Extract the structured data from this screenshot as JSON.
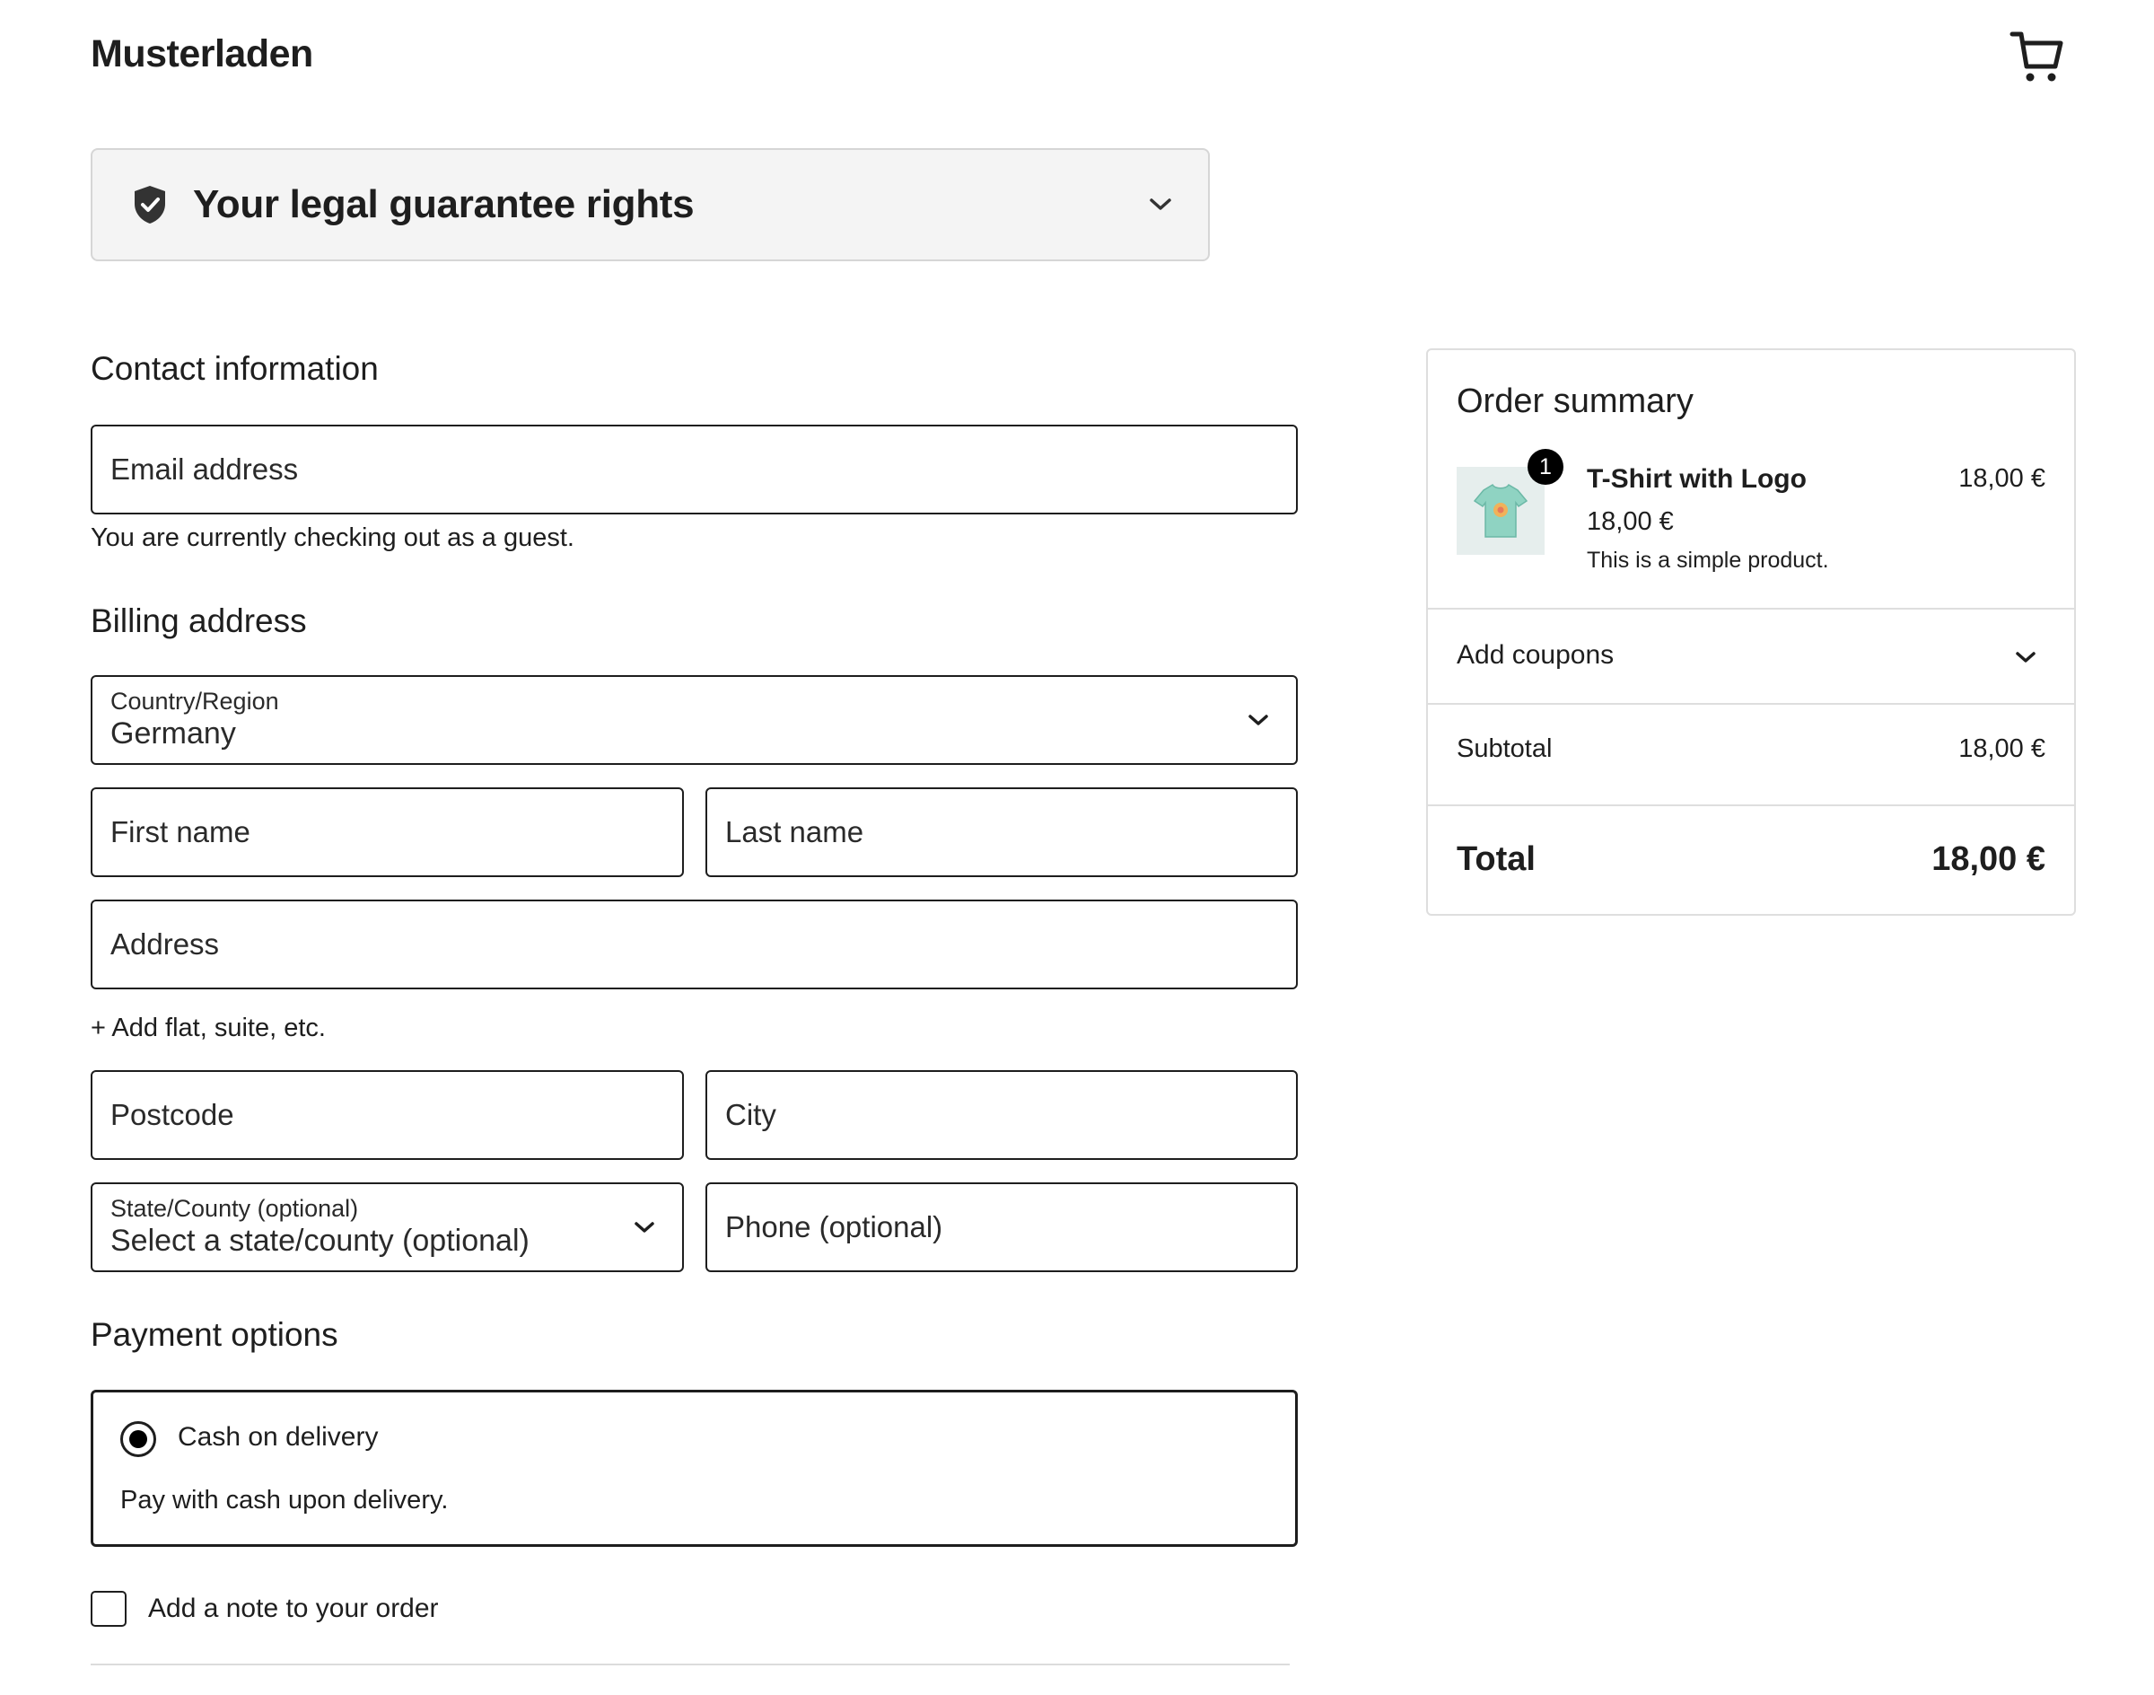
{
  "header": {
    "brand": "Musterladen",
    "cart_icon": "cart-icon"
  },
  "guarantee": {
    "title": "Your legal guarantee rights",
    "icon": "shield-check-icon"
  },
  "contact": {
    "heading": "Contact information",
    "email_label": "Email address",
    "guest_note": "You are currently checking out as a guest."
  },
  "billing": {
    "heading": "Billing address",
    "country_label": "Country/Region",
    "country_value": "Germany",
    "first_name_label": "First name",
    "last_name_label": "Last name",
    "address_label": "Address",
    "add_flat": "+ Add flat, suite, etc.",
    "postcode_label": "Postcode",
    "city_label": "City",
    "state_label": "State/County (optional)",
    "state_value": "Select a state/county (optional)",
    "phone_label": "Phone (optional)"
  },
  "payment": {
    "heading": "Payment options",
    "option_label": "Cash on delivery",
    "option_desc": "Pay with cash upon delivery.",
    "selected": true
  },
  "note": {
    "label": "Add a note to your order",
    "checked": false
  },
  "summary": {
    "heading": "Order summary",
    "item": {
      "name": "T-Shirt with Logo",
      "price": "18,00 €",
      "line_total": "18,00 €",
      "description": "This is a simple product.",
      "quantity": "1"
    },
    "coupons_label": "Add coupons",
    "subtotal_label": "Subtotal",
    "subtotal_value": "18,00 €",
    "total_label": "Total",
    "total_value": "18,00 €"
  }
}
